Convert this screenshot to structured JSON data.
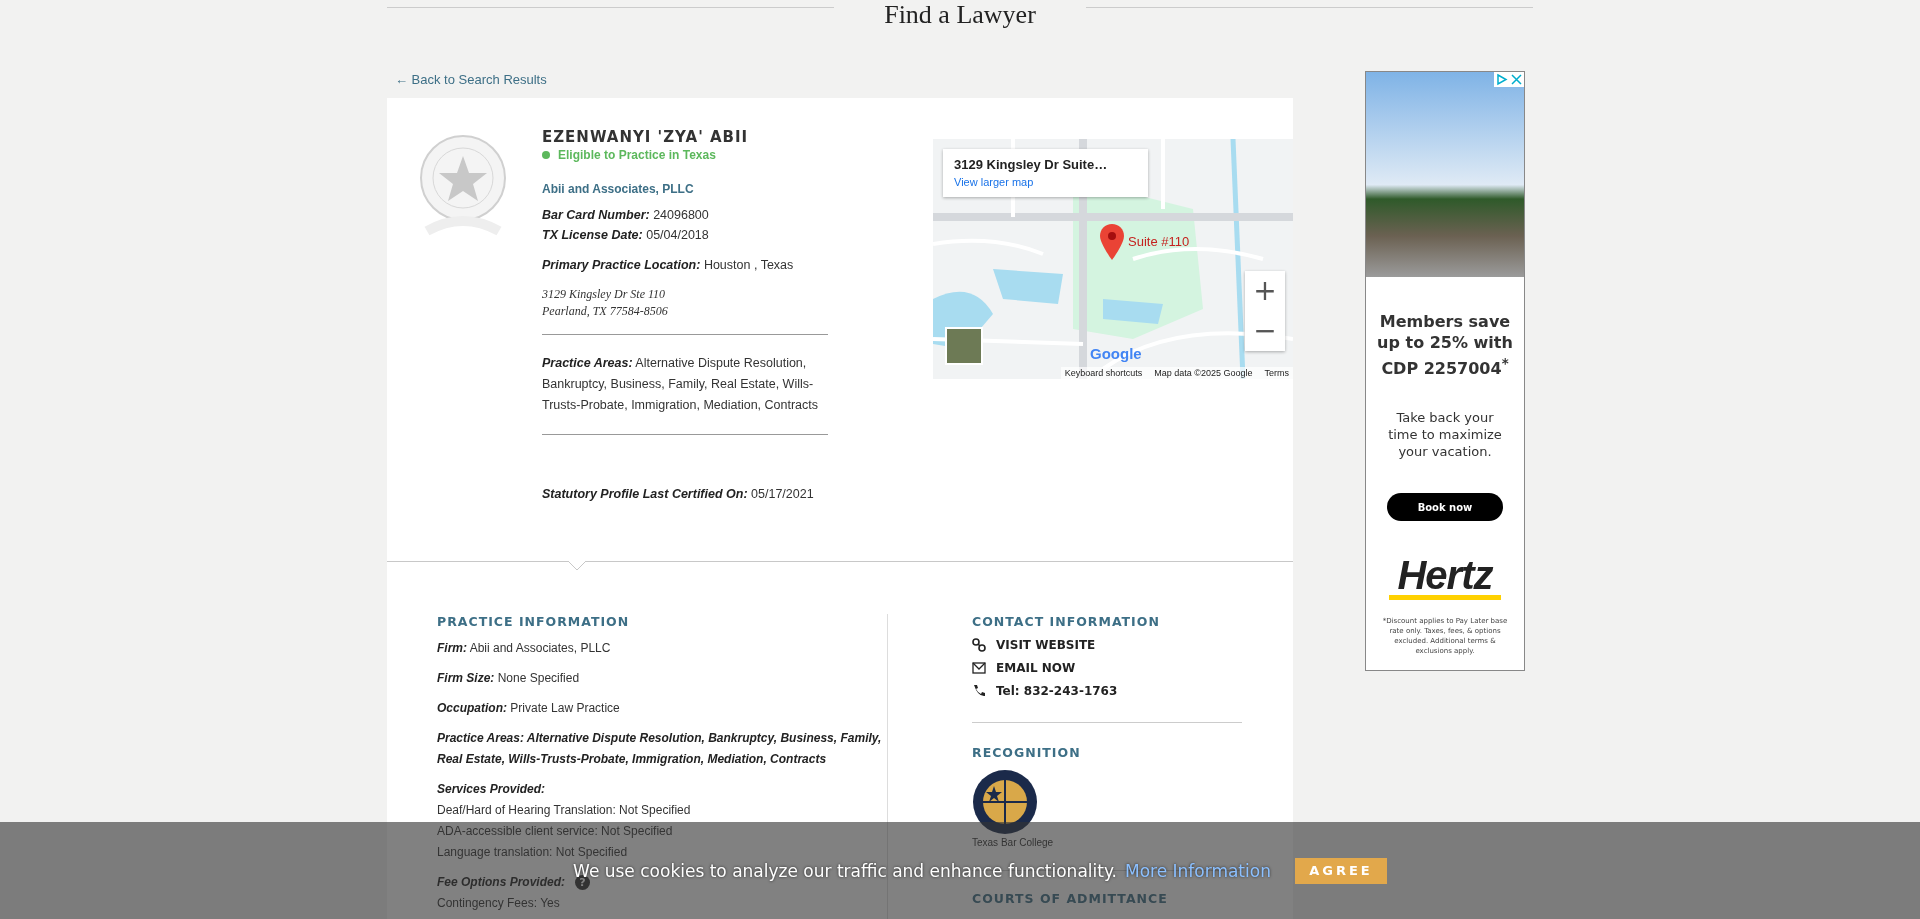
{
  "header": {
    "title": "Find a Lawyer"
  },
  "back_link": {
    "label": "← Back to Search Results"
  },
  "profile": {
    "name": "EZENWANYI 'ZYA' ABII",
    "status": "Eligible to Practice in Texas",
    "firm": "Abii and Associates, PLLC",
    "details": [
      {
        "text": "**Bar Card Number:** 24096800"
      },
      {
        "text": "**TX License Date:** 05/04/2018"
      }
    ],
    "location": "**Primary Practice Location:** Houston , Texas",
    "address": [
      "3129 Kingsley Dr Ste 110",
      "Pearland, TX 77584-8506"
    ],
    "practice_areas": "**Practice Areas:** Alternative Dispute Resolution, Bankruptcy, Business, Family, Real Estate, Wills-Trusts-Probate, Immigration, Mediation, Contracts",
    "certified": "**Statutory Profile Last Certified On:** 05/17/2021"
  },
  "map": {
    "place_title": "3129 Kingsley Dr Suite…",
    "link": "View larger map",
    "marker_label": "Suite #110",
    "zoom_buttons": [
      "+",
      "−"
    ],
    "logo": "Google",
    "attribution": [
      "Keyboard shortcuts",
      "Map data ©2025 Google",
      "Terms"
    ]
  },
  "practice_information": {
    "heading": "PRACTICE INFORMATION",
    "rows": [
      {
        "text": "**Firm:** Abii and Associates, PLLC"
      },
      {
        "text": "**Firm Size:** None Specified"
      },
      {
        "text": "**Occupation:** Private Law Practice"
      },
      {
        "text": "Practice Areas: Alternative Dispute Resolution, Bankruptcy, Business, Family, Real Estate, Wills-Trusts-Probate, Immigration, Mediation, Contracts"
      }
    ],
    "services": {
      "label": "Services Provided:",
      "lines": [
        "Deaf/Hard of Hearing Translation: Not Specified",
        "ADA-accessible client service: Not Specified",
        "Language translation: Not Specified"
      ]
    },
    "fees": {
      "label": "Fee Options Provided:",
      "help": "?",
      "lines": [
        "Contingency Fees: Yes"
      ]
    }
  },
  "contact_information": {
    "heading": "CONTACT INFORMATION",
    "items": [
      {
        "kind": "website",
        "label": "VISIT WEBSITE"
      },
      {
        "kind": "email",
        "label": "EMAIL NOW"
      },
      {
        "kind": "phone",
        "label": "Tel: 832-243-1763"
      }
    ]
  },
  "recognition": {
    "heading": "RECOGNITION",
    "caption": "Texas Bar College"
  },
  "courts": {
    "heading": "COURTS OF ADMITTANCE"
  },
  "ad": {
    "headline": "Members save up to 25% with CDP 2257004$^{*}$",
    "body": "Take back your time to maximize your vacation.",
    "button": "Book now",
    "logo": "Hertz",
    "disclaimer": "*Discount applies to Pay Later base rate only. Taxes, fees, & options excluded. Additional terms & exclusions apply."
  },
  "cookie_bar": {
    "text": "We use cookies to analyze our traffic and enhance functionality.",
    "link": "More Information",
    "button": "AGREE"
  }
}
